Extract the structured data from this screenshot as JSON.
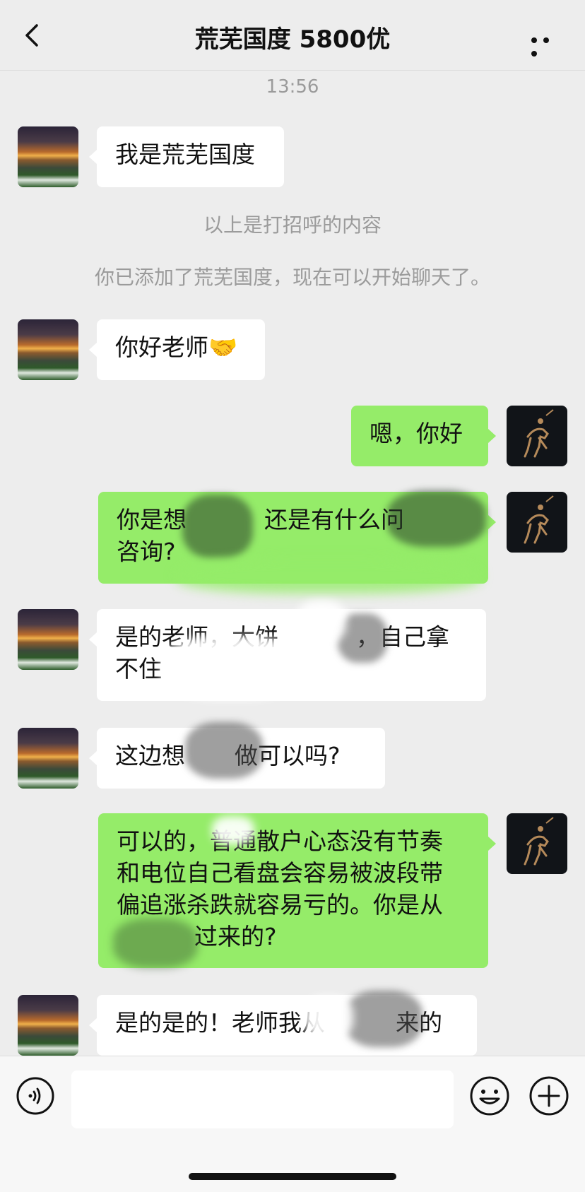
{
  "header": {
    "title": "荒芜国度 5800优",
    "back_icon": "chevron-left-icon",
    "more_icon": "more-dots-icon"
  },
  "chat": {
    "timestamp": "13:56",
    "system_notes": [
      "以上是打招呼的内容",
      "你已添加了荒芜国度，现在可以开始聊天了。"
    ],
    "messages": [
      {
        "side": "in",
        "text": "我是荒芜国度"
      },
      {
        "side": "in",
        "text": "你好老师🤝"
      },
      {
        "side": "out",
        "text": "嗯，你好"
      },
      {
        "side": "out",
        "line1": "你是想",
        "line1b": "还是有什么问",
        "line2": "咨询?"
      },
      {
        "side": "in",
        "line1a": "是的老师，大饼",
        "line1b": "，自己拿",
        "line2": "不住"
      },
      {
        "side": "in",
        "text_a": "这边想",
        "text_b": "做可以吗?"
      },
      {
        "side": "out",
        "line1": "可以的，普通散户心态没有节奏",
        "line2": "和电位自己看盘会容易被波段带",
        "line3": "偏追涨杀跌就容易亏的。你是从",
        "line4": "过来的?"
      },
      {
        "side": "in",
        "text_a": "是的是的！老师我从",
        "text_b": "来的"
      }
    ]
  },
  "colors": {
    "background": "#ededed",
    "incoming_bubble": "#ffffff",
    "outgoing_bubble": "#95ec69",
    "meta_text": "#9b9b9b"
  },
  "bottom_bar": {
    "voice_icon": "voice-icon",
    "emoji_icon": "emoji-icon",
    "plus_icon": "plus-icon",
    "input_value": ""
  }
}
